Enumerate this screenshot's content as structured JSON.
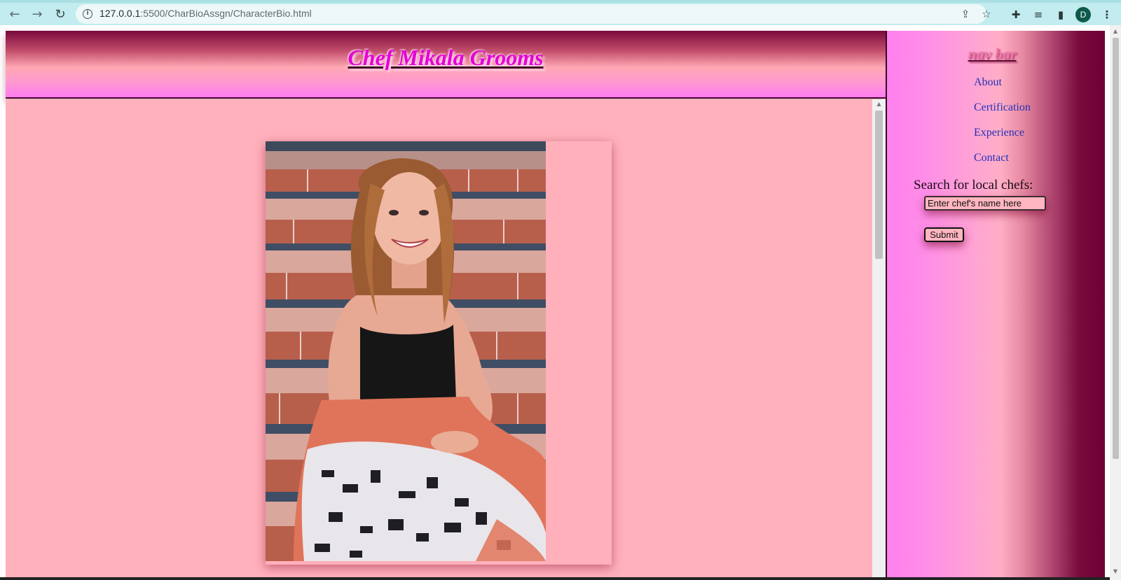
{
  "browser": {
    "url_host": "127.0.0.1",
    "url_rest": ":5500/CharBioAssgn/CharacterBio.html",
    "profile_initial": "D"
  },
  "header": {
    "title": "Chef Mikala Grooms"
  },
  "main": {
    "photo_alt": "Portrait of Chef Mikala Grooms sitting on brick steps"
  },
  "sidebar": {
    "heading": "nav bar",
    "links": [
      {
        "label": "About"
      },
      {
        "label": "Certification"
      },
      {
        "label": "Experience"
      },
      {
        "label": "Contact"
      }
    ],
    "search_label": "Search for local chefs:",
    "search_placeholder": "Enter chef's name here",
    "submit_label": "Submit"
  },
  "colors": {
    "content_bg": "#ffb1bc",
    "link": "#2431b8",
    "title": "#e400d8"
  }
}
